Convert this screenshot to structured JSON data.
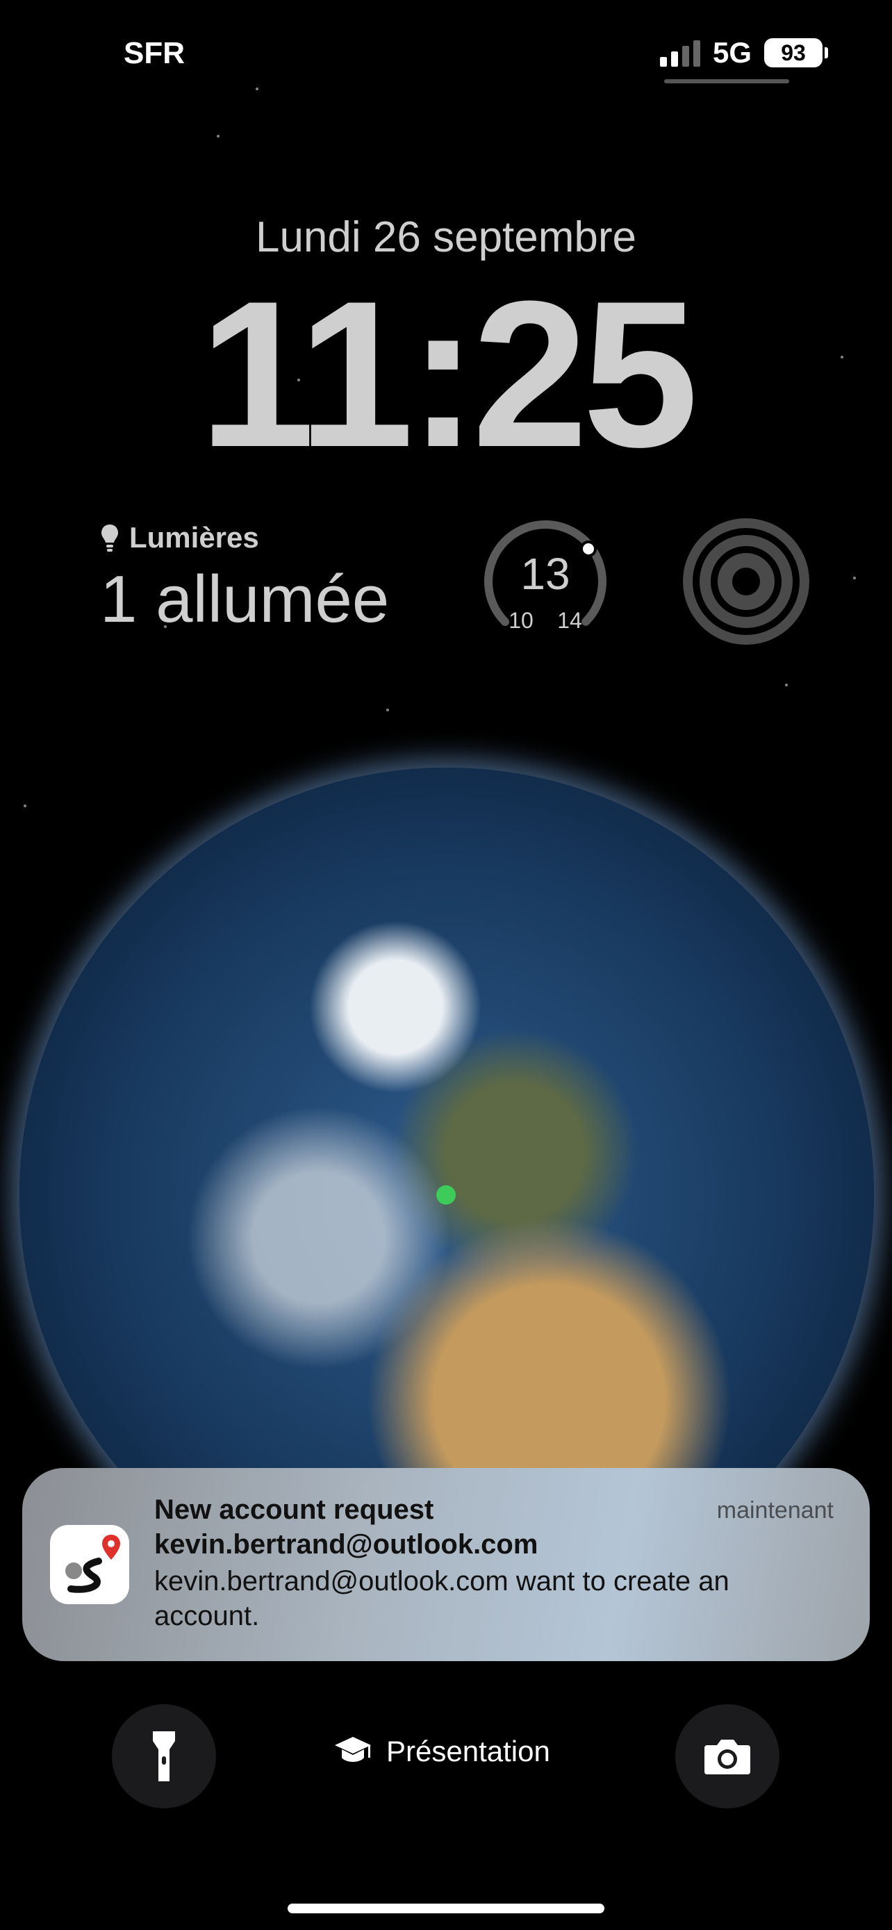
{
  "status_bar": {
    "carrier": "SFR",
    "network": "5G",
    "battery": "93"
  },
  "lock": {
    "date": "Lundi 26 septembre",
    "time": "11:25"
  },
  "widgets": {
    "lights": {
      "label": "Lumières",
      "value": "1 allumée",
      "icon": "lightbulb-icon"
    },
    "temperature": {
      "current": "13",
      "low": "10",
      "high": "14",
      "level": 0.75
    },
    "target": {
      "icon": "activity-rings-icon"
    }
  },
  "notification": {
    "title": "New account request",
    "subtitle": "kevin.bertrand@outlook.com",
    "body": "kevin.bertrand@outlook.com want to create an account.",
    "time": "maintenant",
    "app_icon": "map-pin-route-icon"
  },
  "bottom": {
    "flashlight_icon": "flashlight-icon",
    "focus_label": "Présentation",
    "focus_icon": "graduation-cap-icon",
    "camera_icon": "camera-icon"
  }
}
